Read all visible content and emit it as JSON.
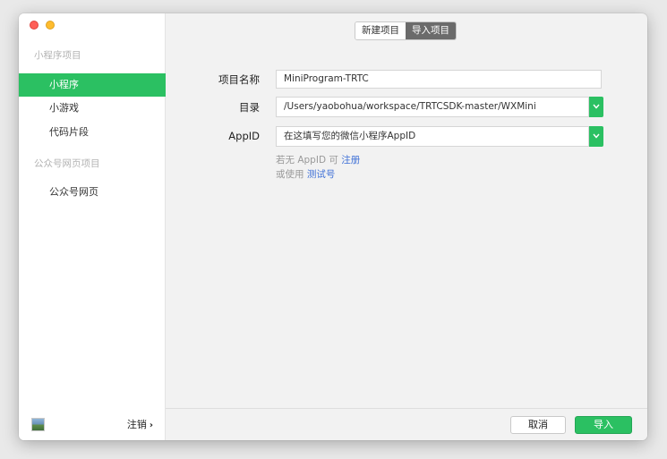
{
  "colors": {
    "accent": "#2bc062",
    "link": "#3d6fd6"
  },
  "sidebar": {
    "sections": [
      {
        "label": "小程序项目",
        "items": [
          {
            "label": "小程序",
            "active": true
          },
          {
            "label": "小游戏"
          },
          {
            "label": "代码片段"
          }
        ]
      },
      {
        "label": "公众号网页项目",
        "items": [
          {
            "label": "公众号网页"
          }
        ]
      }
    ],
    "avatar_icon": "landscape-avatar-icon",
    "logout_label": "注销",
    "logout_icon": "chevron-right-icon"
  },
  "tabs": {
    "new_project": "新建项目",
    "import_project": "导入项目",
    "selected": "import_project"
  },
  "form": {
    "name": {
      "label": "项目名称",
      "value": "MiniProgram-TRTC"
    },
    "directory": {
      "label": "目录",
      "value": "/Users/yaobohua/workspace/TRTCSDK-master/WXMini"
    },
    "appid": {
      "label": "AppID",
      "value": "在这填写您的微信小程序AppID"
    },
    "hint_line1_prefix": "若无 AppID 可",
    "hint_line1_link": "注册",
    "hint_line2_prefix": "或使用",
    "hint_line2_link": "测试号"
  },
  "footer": {
    "cancel_label": "取消",
    "import_label": "导入"
  }
}
